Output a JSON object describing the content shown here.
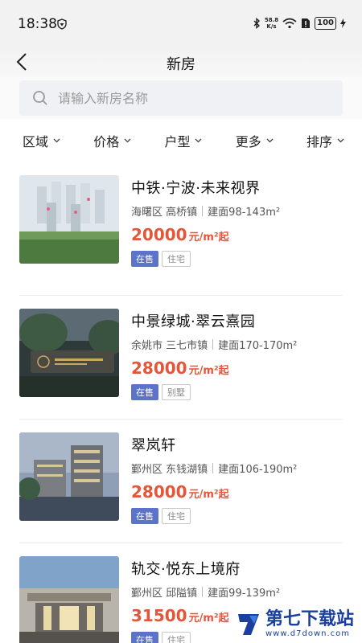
{
  "status_bar": {
    "time": "18:38",
    "net_speed_value": "58.8",
    "net_speed_unit": "K/s",
    "battery": "100"
  },
  "header": {
    "title": "新房"
  },
  "search": {
    "placeholder": "请输入新房名称",
    "value": ""
  },
  "filters": [
    {
      "label": "区域"
    },
    {
      "label": "价格"
    },
    {
      "label": "户型"
    },
    {
      "label": "更多"
    },
    {
      "label": "排序"
    }
  ],
  "listings": [
    {
      "name": "中铁·宁波·未来视界",
      "district": "海曙区",
      "town": "高桥镇",
      "area": "建面98-143m²",
      "price": "20000",
      "unit": "元/m²起",
      "status": "在售",
      "type": "住宅"
    },
    {
      "name": "中景绿城·翠云熹园",
      "district": "余姚市",
      "town": "三七市镇",
      "area": "建面170-170m²",
      "price": "28000",
      "unit": "元/m²起",
      "status": "在售",
      "type": "别墅"
    },
    {
      "name": "翠岚轩",
      "district": "鄞州区",
      "town": "东钱湖镇",
      "area": "建面106-190m²",
      "price": "28000",
      "unit": "元/m²起",
      "status": "在售",
      "type": "住宅"
    },
    {
      "name": "轨交·悦东上境府",
      "district": "鄞州区",
      "town": "邱隘镇",
      "area": "建面99-139m²",
      "price": "31500",
      "unit": "元/m²起",
      "status": "在售",
      "type": "住宅"
    }
  ],
  "watermark": {
    "main": "第七下载站",
    "sub": "www.d7down.com"
  },
  "colors": {
    "price": "#e2563a",
    "tag_sale": "#5b73c8",
    "watermark": "#1a3f9c"
  }
}
